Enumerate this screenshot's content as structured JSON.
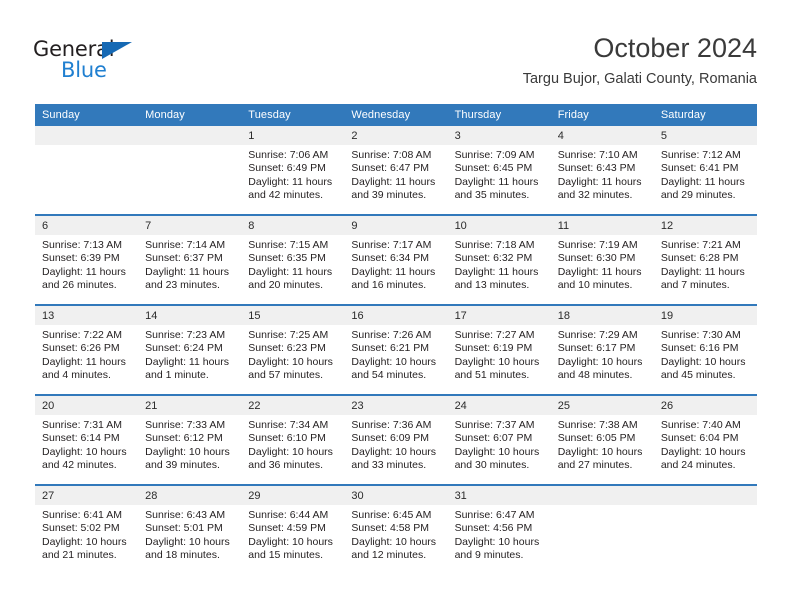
{
  "brand": {
    "name_part1": "General",
    "name_part2": "Blue",
    "triangle_color": "#1669b4",
    "blue_text_color": "#1f7fd0"
  },
  "header": {
    "month_title": "October 2024",
    "location": "Targu Bujor, Galati County, Romania"
  },
  "theme": {
    "header_blue": "#3279bb",
    "datenum_gray": "#f0f0f0",
    "text_color": "#231f20"
  },
  "weekday_headers": [
    "Sunday",
    "Monday",
    "Tuesday",
    "Wednesday",
    "Thursday",
    "Friday",
    "Saturday"
  ],
  "weeks": [
    [
      {
        "day": "",
        "sunrise": "",
        "sunset": "",
        "daylight1": "",
        "daylight2": ""
      },
      {
        "day": "",
        "sunrise": "",
        "sunset": "",
        "daylight1": "",
        "daylight2": ""
      },
      {
        "day": "1",
        "sunrise": "Sunrise: 7:06 AM",
        "sunset": "Sunset: 6:49 PM",
        "daylight1": "Daylight: 11 hours",
        "daylight2": "and 42 minutes."
      },
      {
        "day": "2",
        "sunrise": "Sunrise: 7:08 AM",
        "sunset": "Sunset: 6:47 PM",
        "daylight1": "Daylight: 11 hours",
        "daylight2": "and 39 minutes."
      },
      {
        "day": "3",
        "sunrise": "Sunrise: 7:09 AM",
        "sunset": "Sunset: 6:45 PM",
        "daylight1": "Daylight: 11 hours",
        "daylight2": "and 35 minutes."
      },
      {
        "day": "4",
        "sunrise": "Sunrise: 7:10 AM",
        "sunset": "Sunset: 6:43 PM",
        "daylight1": "Daylight: 11 hours",
        "daylight2": "and 32 minutes."
      },
      {
        "day": "5",
        "sunrise": "Sunrise: 7:12 AM",
        "sunset": "Sunset: 6:41 PM",
        "daylight1": "Daylight: 11 hours",
        "daylight2": "and 29 minutes."
      }
    ],
    [
      {
        "day": "6",
        "sunrise": "Sunrise: 7:13 AM",
        "sunset": "Sunset: 6:39 PM",
        "daylight1": "Daylight: 11 hours",
        "daylight2": "and 26 minutes."
      },
      {
        "day": "7",
        "sunrise": "Sunrise: 7:14 AM",
        "sunset": "Sunset: 6:37 PM",
        "daylight1": "Daylight: 11 hours",
        "daylight2": "and 23 minutes."
      },
      {
        "day": "8",
        "sunrise": "Sunrise: 7:15 AM",
        "sunset": "Sunset: 6:35 PM",
        "daylight1": "Daylight: 11 hours",
        "daylight2": "and 20 minutes."
      },
      {
        "day": "9",
        "sunrise": "Sunrise: 7:17 AM",
        "sunset": "Sunset: 6:34 PM",
        "daylight1": "Daylight: 11 hours",
        "daylight2": "and 16 minutes."
      },
      {
        "day": "10",
        "sunrise": "Sunrise: 7:18 AM",
        "sunset": "Sunset: 6:32 PM",
        "daylight1": "Daylight: 11 hours",
        "daylight2": "and 13 minutes."
      },
      {
        "day": "11",
        "sunrise": "Sunrise: 7:19 AM",
        "sunset": "Sunset: 6:30 PM",
        "daylight1": "Daylight: 11 hours",
        "daylight2": "and 10 minutes."
      },
      {
        "day": "12",
        "sunrise": "Sunrise: 7:21 AM",
        "sunset": "Sunset: 6:28 PM",
        "daylight1": "Daylight: 11 hours",
        "daylight2": "and 7 minutes."
      }
    ],
    [
      {
        "day": "13",
        "sunrise": "Sunrise: 7:22 AM",
        "sunset": "Sunset: 6:26 PM",
        "daylight1": "Daylight: 11 hours",
        "daylight2": "and 4 minutes."
      },
      {
        "day": "14",
        "sunrise": "Sunrise: 7:23 AM",
        "sunset": "Sunset: 6:24 PM",
        "daylight1": "Daylight: 11 hours",
        "daylight2": "and 1 minute."
      },
      {
        "day": "15",
        "sunrise": "Sunrise: 7:25 AM",
        "sunset": "Sunset: 6:23 PM",
        "daylight1": "Daylight: 10 hours",
        "daylight2": "and 57 minutes."
      },
      {
        "day": "16",
        "sunrise": "Sunrise: 7:26 AM",
        "sunset": "Sunset: 6:21 PM",
        "daylight1": "Daylight: 10 hours",
        "daylight2": "and 54 minutes."
      },
      {
        "day": "17",
        "sunrise": "Sunrise: 7:27 AM",
        "sunset": "Sunset: 6:19 PM",
        "daylight1": "Daylight: 10 hours",
        "daylight2": "and 51 minutes."
      },
      {
        "day": "18",
        "sunrise": "Sunrise: 7:29 AM",
        "sunset": "Sunset: 6:17 PM",
        "daylight1": "Daylight: 10 hours",
        "daylight2": "and 48 minutes."
      },
      {
        "day": "19",
        "sunrise": "Sunrise: 7:30 AM",
        "sunset": "Sunset: 6:16 PM",
        "daylight1": "Daylight: 10 hours",
        "daylight2": "and 45 minutes."
      }
    ],
    [
      {
        "day": "20",
        "sunrise": "Sunrise: 7:31 AM",
        "sunset": "Sunset: 6:14 PM",
        "daylight1": "Daylight: 10 hours",
        "daylight2": "and 42 minutes."
      },
      {
        "day": "21",
        "sunrise": "Sunrise: 7:33 AM",
        "sunset": "Sunset: 6:12 PM",
        "daylight1": "Daylight: 10 hours",
        "daylight2": "and 39 minutes."
      },
      {
        "day": "22",
        "sunrise": "Sunrise: 7:34 AM",
        "sunset": "Sunset: 6:10 PM",
        "daylight1": "Daylight: 10 hours",
        "daylight2": "and 36 minutes."
      },
      {
        "day": "23",
        "sunrise": "Sunrise: 7:36 AM",
        "sunset": "Sunset: 6:09 PM",
        "daylight1": "Daylight: 10 hours",
        "daylight2": "and 33 minutes."
      },
      {
        "day": "24",
        "sunrise": "Sunrise: 7:37 AM",
        "sunset": "Sunset: 6:07 PM",
        "daylight1": "Daylight: 10 hours",
        "daylight2": "and 30 minutes."
      },
      {
        "day": "25",
        "sunrise": "Sunrise: 7:38 AM",
        "sunset": "Sunset: 6:05 PM",
        "daylight1": "Daylight: 10 hours",
        "daylight2": "and 27 minutes."
      },
      {
        "day": "26",
        "sunrise": "Sunrise: 7:40 AM",
        "sunset": "Sunset: 6:04 PM",
        "daylight1": "Daylight: 10 hours",
        "daylight2": "and 24 minutes."
      }
    ],
    [
      {
        "day": "27",
        "sunrise": "Sunrise: 6:41 AM",
        "sunset": "Sunset: 5:02 PM",
        "daylight1": "Daylight: 10 hours",
        "daylight2": "and 21 minutes."
      },
      {
        "day": "28",
        "sunrise": "Sunrise: 6:43 AM",
        "sunset": "Sunset: 5:01 PM",
        "daylight1": "Daylight: 10 hours",
        "daylight2": "and 18 minutes."
      },
      {
        "day": "29",
        "sunrise": "Sunrise: 6:44 AM",
        "sunset": "Sunset: 4:59 PM",
        "daylight1": "Daylight: 10 hours",
        "daylight2": "and 15 minutes."
      },
      {
        "day": "30",
        "sunrise": "Sunrise: 6:45 AM",
        "sunset": "Sunset: 4:58 PM",
        "daylight1": "Daylight: 10 hours",
        "daylight2": "and 12 minutes."
      },
      {
        "day": "31",
        "sunrise": "Sunrise: 6:47 AM",
        "sunset": "Sunset: 4:56 PM",
        "daylight1": "Daylight: 10 hours",
        "daylight2": "and 9 minutes."
      },
      {
        "day": "",
        "sunrise": "",
        "sunset": "",
        "daylight1": "",
        "daylight2": ""
      },
      {
        "day": "",
        "sunrise": "",
        "sunset": "",
        "daylight1": "",
        "daylight2": ""
      }
    ]
  ]
}
